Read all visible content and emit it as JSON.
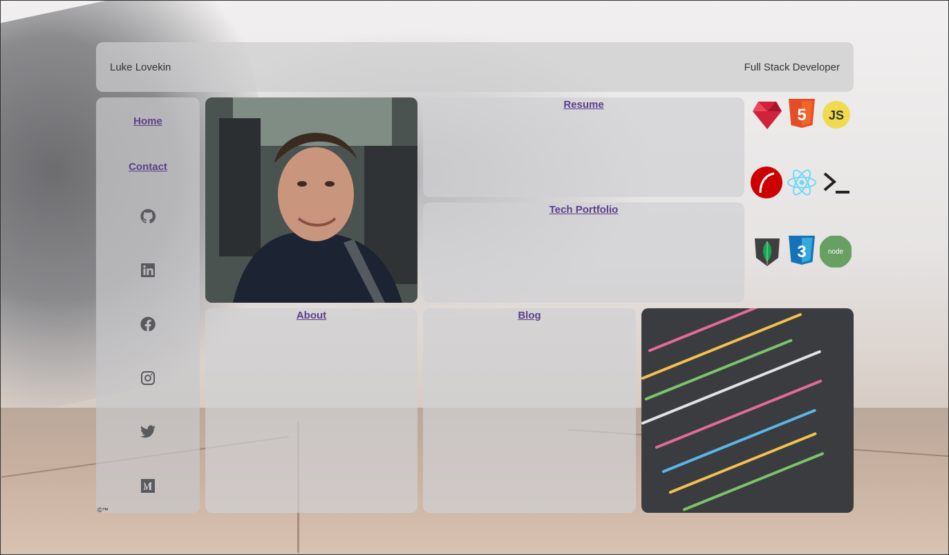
{
  "header": {
    "name": "Luke Lovekin",
    "title": "Full Stack Developer"
  },
  "nav": {
    "home": "Home",
    "contact": "Contact"
  },
  "social": [
    "github-icon",
    "linkedin-icon",
    "facebook-icon",
    "instagram-icon",
    "twitter-icon",
    "medium-icon"
  ],
  "cards": {
    "resume": "Resume",
    "portfolio": "Tech Portfolio",
    "about": "About",
    "blog": "Blog"
  },
  "tech_icons": [
    "ruby-icon",
    "html5-icon",
    "javascript-icon",
    "rails-icon",
    "react-icon",
    "terminal-icon",
    "mongodb-icon",
    "css3-icon",
    "nodejs-icon"
  ],
  "footer": {
    "mark": "©™"
  },
  "colors": {
    "link": "#5b3f8a",
    "panel": "#cdcdcf"
  }
}
